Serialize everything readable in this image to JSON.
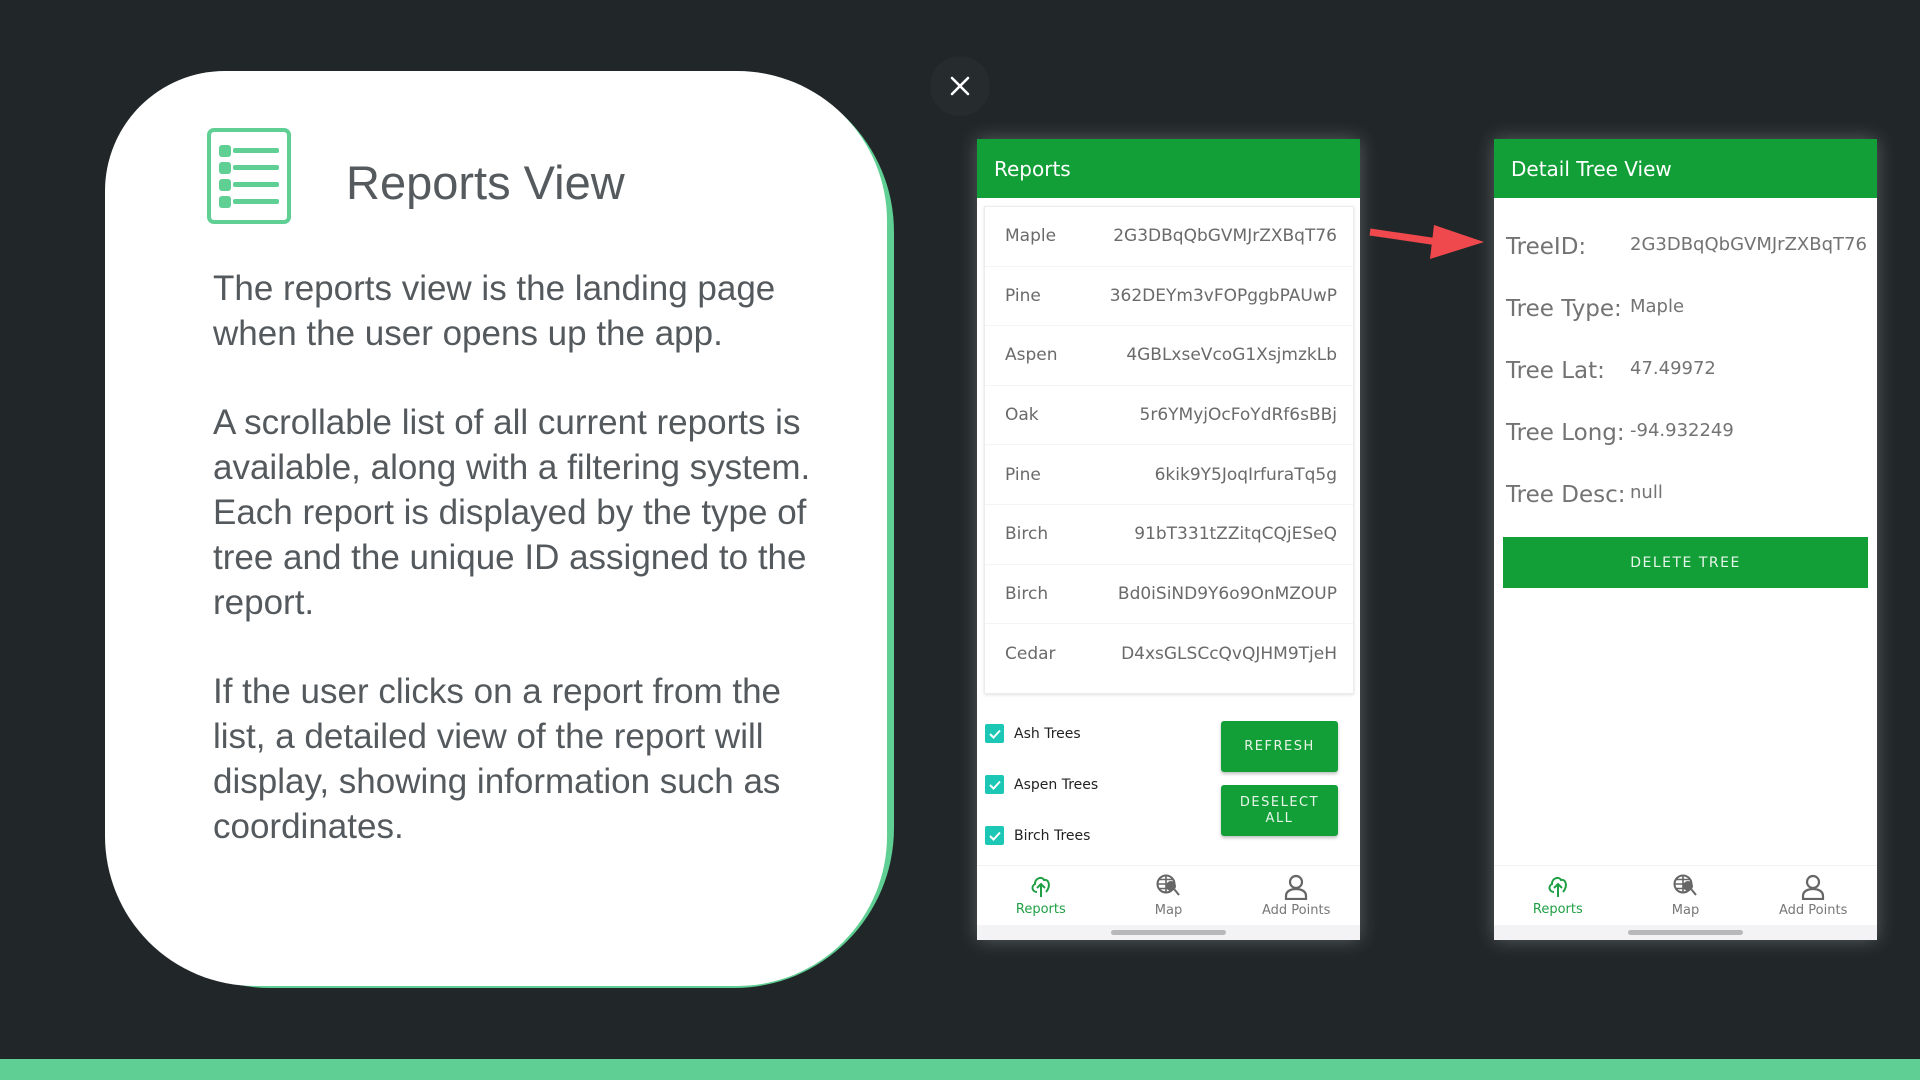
{
  "card": {
    "icon": "list-document-icon",
    "title": "Reports View",
    "paragraphs": [
      "The reports view is the landing page when the user opens up the app.",
      "A scrollable list of all current reports is available, along with a filtering system. Each report is displayed by the type of tree and the unique ID assigned to the report.",
      "If the user clicks on a report from the list, a detailed view of the report will display, showing information such as coordinates."
    ]
  },
  "close_button": {
    "icon": "close-icon"
  },
  "reports_screen": {
    "header": "Reports",
    "reports": [
      {
        "type": "Maple",
        "id": "2G3DBqQbGVMJrZXBqT76"
      },
      {
        "type": "Pine",
        "id": "362DEYm3vFOPggbPAUwP"
      },
      {
        "type": "Aspen",
        "id": "4GBLxseVcoG1XsjmzkLb"
      },
      {
        "type": "Oak",
        "id": "5r6YMyjOcFoYdRf6sBBj"
      },
      {
        "type": "Pine",
        "id": "6kik9Y5JoqIrfuraTq5g"
      },
      {
        "type": "Birch",
        "id": "91bT331tZZitqCQjESeQ"
      },
      {
        "type": "Birch",
        "id": "Bd0iSiND9Y6o9OnMZOUP"
      },
      {
        "type": "Cedar",
        "id": "D4xsGLSCcQvQJHM9TjeH"
      }
    ],
    "filters": [
      {
        "label": "Ash Trees",
        "checked": true
      },
      {
        "label": "Aspen Trees",
        "checked": true
      },
      {
        "label": "Birch Trees",
        "checked": true
      }
    ],
    "refresh_label": "REFRESH",
    "deselect_label_line1": "DESELECT",
    "deselect_label_line2": "ALL"
  },
  "detail_screen": {
    "header": "Detail Tree View",
    "fields": [
      {
        "label": "TreeID:",
        "value": "2G3DBqQbGVMJrZXBqT76"
      },
      {
        "label": "Tree Type:",
        "value": "Maple"
      },
      {
        "label": "Tree Lat:",
        "value": "47.49972"
      },
      {
        "label": "Tree Long:",
        "value": "-94.932249"
      },
      {
        "label": "Tree Desc:",
        "value": "null"
      }
    ],
    "delete_label": "DELETE TREE"
  },
  "nav": [
    {
      "label": "Reports",
      "icon": "tree-upload-icon",
      "active": true
    },
    {
      "label": "Map",
      "icon": "globe-search-icon",
      "active": false
    },
    {
      "label": "Add Points",
      "icon": "person-icon",
      "active": false
    }
  ],
  "colors": {
    "background": "#212729",
    "accent_green": "#139f37",
    "mint": "#5fcf93",
    "checkbox": "#1dc7b5",
    "arrow": "#f0494d"
  }
}
